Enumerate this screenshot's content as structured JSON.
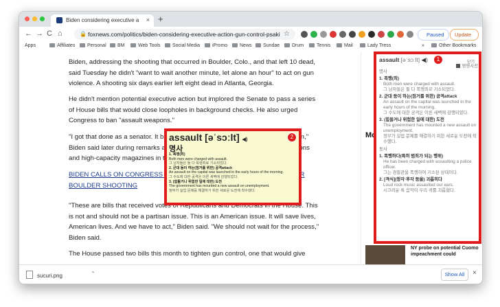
{
  "tab": {
    "title": "Biden considering executive a",
    "close": "×"
  },
  "new_tab": "+",
  "toolbar": {
    "back": "←",
    "forward": "→",
    "reload": "C",
    "home": "⌂",
    "url": "foxnews.com/politics/biden-considering-executive-action-gun-control-psaki",
    "paused": "Paused",
    "update": "Update"
  },
  "bookmarks": [
    "Apps",
    "Affiliates",
    "Personal",
    "BM",
    "Web Tools",
    "Social Media",
    "iPromo",
    "News",
    "Sundae",
    "Drum",
    "Tennis",
    "Mail",
    "Lady Tress",
    "»",
    "Other Bookmarks"
  ],
  "article": {
    "p1": "Biden, addressing the shooting that occurred in Boulder, Colo., and that left 10 dead, said Tuesday he didn't \"want to wait another minute, let alone an hour\" to act on gun violence. A shooting six days earlier left eight dead in Atlanta, Georgia.",
    "p2": "He didn't mention potential executive action but implored the Senate to pass a series of House bills that would close loopholes in background checks. He also urged Congress to ban \"assault weapons.\"",
    "p3_a": "\"I got that done as a senator. It brought down mass shootings, we can do it again,\" Biden said later during remarks at the White House. \"We can ban ",
    "p3_hl": "assault",
    "p3_b": " weapons and high-capacity magazines in this country once again.\"",
    "link": "BIDEN CALLS ON CONGRESS TO PASS GUN CONTROL MEASURES AFTER BOULDER SHOOTING",
    "p4": "\"These are bills that received votes of Republicans and Democrats in the House. This is not and should not be a partisan issue. This is an American issue. It will save lives, American lives. And we have to act,\" Biden said. \"We should not wait for the process,\" Biden said.",
    "p5": "The House passed two bills this month to tighten gun control, one that would give"
  },
  "popup": {
    "word": "assault [əˈsɔːlt]",
    "speaker": "◀)",
    "pos": "명사",
    "number": "2",
    "lines": [
      "1. 폭행(죄)",
      "Both men were charged with assault.",
      "그 남자들은 둘 다 폭행죄로 기소되었다.",
      "2. 군대 등이 하는(점거를 위한) 공격attack",
      "An assault on the capital was launched in the early hours of the morning.",
      "그 수도에 대한 공격은 이른 새벽에 감행되었다.",
      "3. (힘들거나 위험한 일에 대한) 도전",
      "The government has mounted a new assault on unemployment.",
      "정부가 실업 문제를 해결하기 위한 새로운 도전에 착수했다."
    ]
  },
  "panel": {
    "word": "assault",
    "phonetic": "[əˈsɔːlt]",
    "close": "닫기",
    "dict": "영영사전",
    "number": "1",
    "pos_noun": "명사",
    "noun_entries": [
      {
        "head": "1. 폭행(죄)",
        "en": "Both men were charged with assault.",
        "ko": "그 남자들은 둘 다 폭행죄로 기소되었다."
      },
      {
        "head": "2. 군대 등이 하는(점거를 위한) 공격attack",
        "en": "An assault on the capital was launched in the early hours of the morning.",
        "ko": "그 수도에 대한 공격은 이른 새벽에 감행되었다."
      },
      {
        "head": "3. (힘들거나 위험한 일에 대한) 도전",
        "en": "The government has mounted a new assault on unemployment.",
        "ko": "정부가 실업 문제를 해결하기 위한 새로운 도전에 착수했다."
      }
    ],
    "pos_verb": "동사",
    "verb_entries": [
      {
        "head": "1. 폭행하다(특히 범죄가 되는 행위)",
        "en": "He has been charged with assaulting a police officer.",
        "ko": "그는 경찰관을 폭행하여 기소된 상태이다."
      },
      {
        "head": "2. [격식](청각·후각 등을) 괴롭히다",
        "en": "Loud rock music assaulted our ears.",
        "ko": "시끄러운 록 음악이 우리 귀를 괴롭혔다."
      }
    ]
  },
  "sidebar": {
    "mo": "Mo",
    "news": "NY probe on potential Cuomo impeachment could"
  },
  "download": {
    "file": "sucuri.png",
    "show_all": "Show All",
    "close": "×"
  },
  "colors": {
    "red_highlight": "#e01b1b",
    "popup_bg": "#fafad2",
    "word_hl": "#1e3c8c"
  }
}
